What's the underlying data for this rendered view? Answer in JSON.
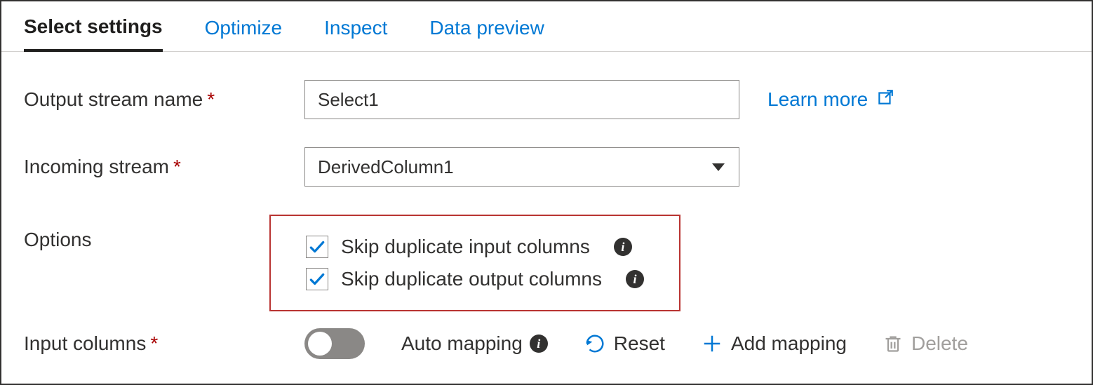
{
  "tabs": [
    {
      "label": "Select settings",
      "active": true
    },
    {
      "label": "Optimize",
      "active": false
    },
    {
      "label": "Inspect",
      "active": false
    },
    {
      "label": "Data preview",
      "active": false
    }
  ],
  "link": {
    "learn_more": "Learn more"
  },
  "fields": {
    "output_stream": {
      "label": "Output stream name",
      "required": true,
      "value": "Select1"
    },
    "incoming_stream": {
      "label": "Incoming stream",
      "required": true,
      "value": "DerivedColumn1"
    },
    "options": {
      "label": "Options",
      "skip_input": {
        "label": "Skip duplicate input columns",
        "checked": true
      },
      "skip_output": {
        "label": "Skip duplicate output columns",
        "checked": true
      }
    },
    "input_columns": {
      "label": "Input columns",
      "required": true
    }
  },
  "toolbar": {
    "auto_mapping": {
      "label": "Auto mapping",
      "on": false
    },
    "reset": "Reset",
    "add_mapping": "Add mapping",
    "delete": "Delete"
  },
  "icons": {
    "info_glyph": "i"
  }
}
